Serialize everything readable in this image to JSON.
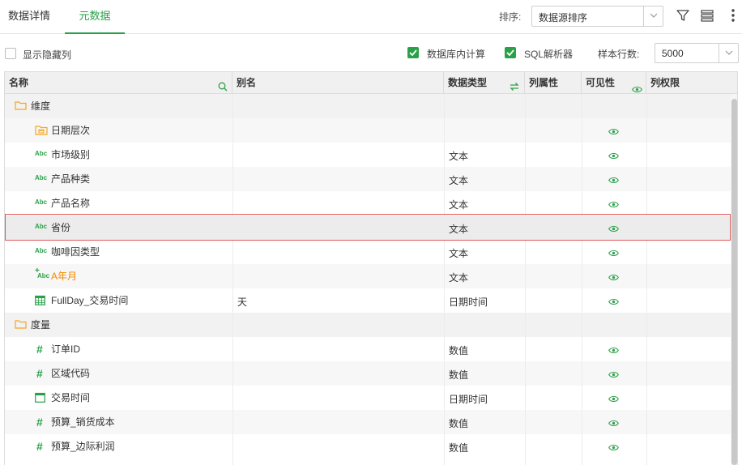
{
  "tabs": [
    {
      "label": "数据详情"
    },
    {
      "label": "元数据"
    }
  ],
  "toolbar": {
    "sort_label": "排序:",
    "sort_value": "数据源排序"
  },
  "options": {
    "show_hidden_label": "显示隐藏列",
    "show_hidden_checked": false,
    "db_calc_label": "数据库内计算",
    "db_calc_checked": true,
    "sql_parser_label": "SQL解析器",
    "sql_parser_checked": true,
    "sample_rows_label": "样本行数:",
    "sample_rows_value": "5000"
  },
  "columns": {
    "name": "名称",
    "alias": "别名",
    "type": "数据类型",
    "attr": "列属性",
    "visibility": "可见性",
    "permission": "列权限"
  },
  "rows": [
    {
      "name": "维度",
      "alias": "",
      "type": "",
      "icon": "folder-icon",
      "visible": false
    },
    {
      "name": "日期层次",
      "alias": "",
      "type": "",
      "icon": "date-hierarchy-icon",
      "visible": true
    },
    {
      "name": "市场级别",
      "alias": "",
      "type": "文本",
      "icon": "abc-icon",
      "visible": true
    },
    {
      "name": "产品种类",
      "alias": "",
      "type": "文本",
      "icon": "abc-icon",
      "visible": true
    },
    {
      "name": "产品名称",
      "alias": "",
      "type": "文本",
      "icon": "abc-icon",
      "visible": true
    },
    {
      "name": "省份",
      "alias": "",
      "type": "文本",
      "icon": "abc-icon",
      "visible": true
    },
    {
      "name": "咖啡因类型",
      "alias": "",
      "type": "文本",
      "icon": "abc-icon",
      "visible": true
    },
    {
      "name": "A年月",
      "alias": "",
      "type": "文本",
      "icon": "calc-abc-icon",
      "visible": true
    },
    {
      "name": "FullDay_交易时间",
      "alias": "天",
      "type": "日期时间",
      "icon": "calendar-grid-icon",
      "visible": true
    },
    {
      "name": "度量",
      "alias": "",
      "type": "",
      "icon": "folder-icon",
      "visible": false
    },
    {
      "name": "订单ID",
      "alias": "",
      "type": "数值",
      "icon": "hash-icon",
      "visible": true
    },
    {
      "name": "区域代码",
      "alias": "",
      "type": "数值",
      "icon": "hash-icon",
      "visible": true
    },
    {
      "name": "交易时间",
      "alias": "",
      "type": "日期时间",
      "icon": "calendar-icon",
      "visible": true
    },
    {
      "name": "预算_销货成本",
      "alias": "",
      "type": "数值",
      "icon": "hash-icon",
      "visible": true
    },
    {
      "name": "预算_边际利润",
      "alias": "",
      "type": "数值",
      "icon": "hash-icon",
      "visible": true
    }
  ],
  "colors": {
    "accent": "#2aa148",
    "folder": "#f5a623",
    "highlight_border": "#e05a5a"
  }
}
